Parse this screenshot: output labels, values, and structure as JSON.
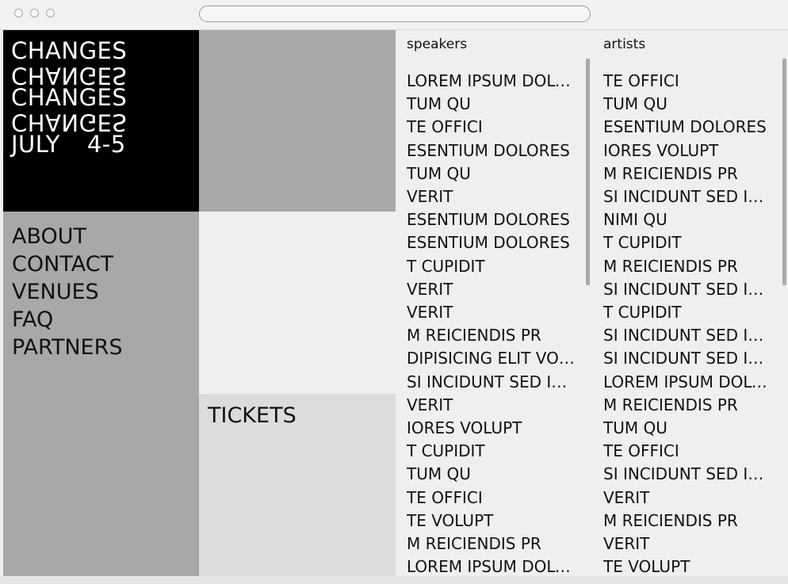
{
  "logo": {
    "lines": [
      "CHANGES",
      "CHANGES",
      "CHANGES",
      "CHANGES"
    ],
    "month": "JULY",
    "days": "4-5"
  },
  "nav": [
    "ABOUT",
    "CONTACT",
    "VENUES",
    "FAQ",
    "PARTNERS"
  ],
  "tickets": "TICKETS",
  "speakers": {
    "heading": "speakers",
    "items": [
      "LOREM IPSUM DOLOR SIT AMET",
      "TUM QU",
      "TE OFFICI",
      "ESENTIUM DOLORES",
      "TUM QU",
      "VERIT",
      "ESENTIUM DOLORES",
      "ESENTIUM DOLORES",
      "T CUPIDIT",
      "VERIT",
      "VERIT",
      "M REICIENDIS PR",
      "DIPISICING ELIT VOLUPT",
      "SI INCIDUNT SED IPSUM",
      "VERIT",
      "IORES VOLUPT",
      "T CUPIDIT",
      "TUM QU",
      "TE OFFICI",
      "TE VOLUPT",
      "M REICIENDIS PR",
      "LOREM IPSUM DOLOR SIT AMET"
    ]
  },
  "artists": {
    "heading": "artists",
    "items": [
      "TE OFFICI",
      "TUM QU",
      "ESENTIUM DOLORES",
      "IORES VOLUPT",
      "M REICIENDIS PR",
      "SI INCIDUNT SED IPSUM",
      "NIMI QU",
      "T CUPIDIT",
      "M REICIENDIS PR",
      "SI INCIDUNT SED IPSUM",
      "T CUPIDIT",
      "SI INCIDUNT SED IPSUM",
      "SI INCIDUNT SED IPSUM",
      "LOREM IPSUM DOLOR SIT AMET",
      "M REICIENDIS PR",
      "TUM QU",
      "TE OFFICI",
      "SI INCIDUNT SED IPSUM",
      "VERIT",
      "M REICIENDIS PR",
      "VERIT",
      "TE VOLUPT"
    ]
  }
}
